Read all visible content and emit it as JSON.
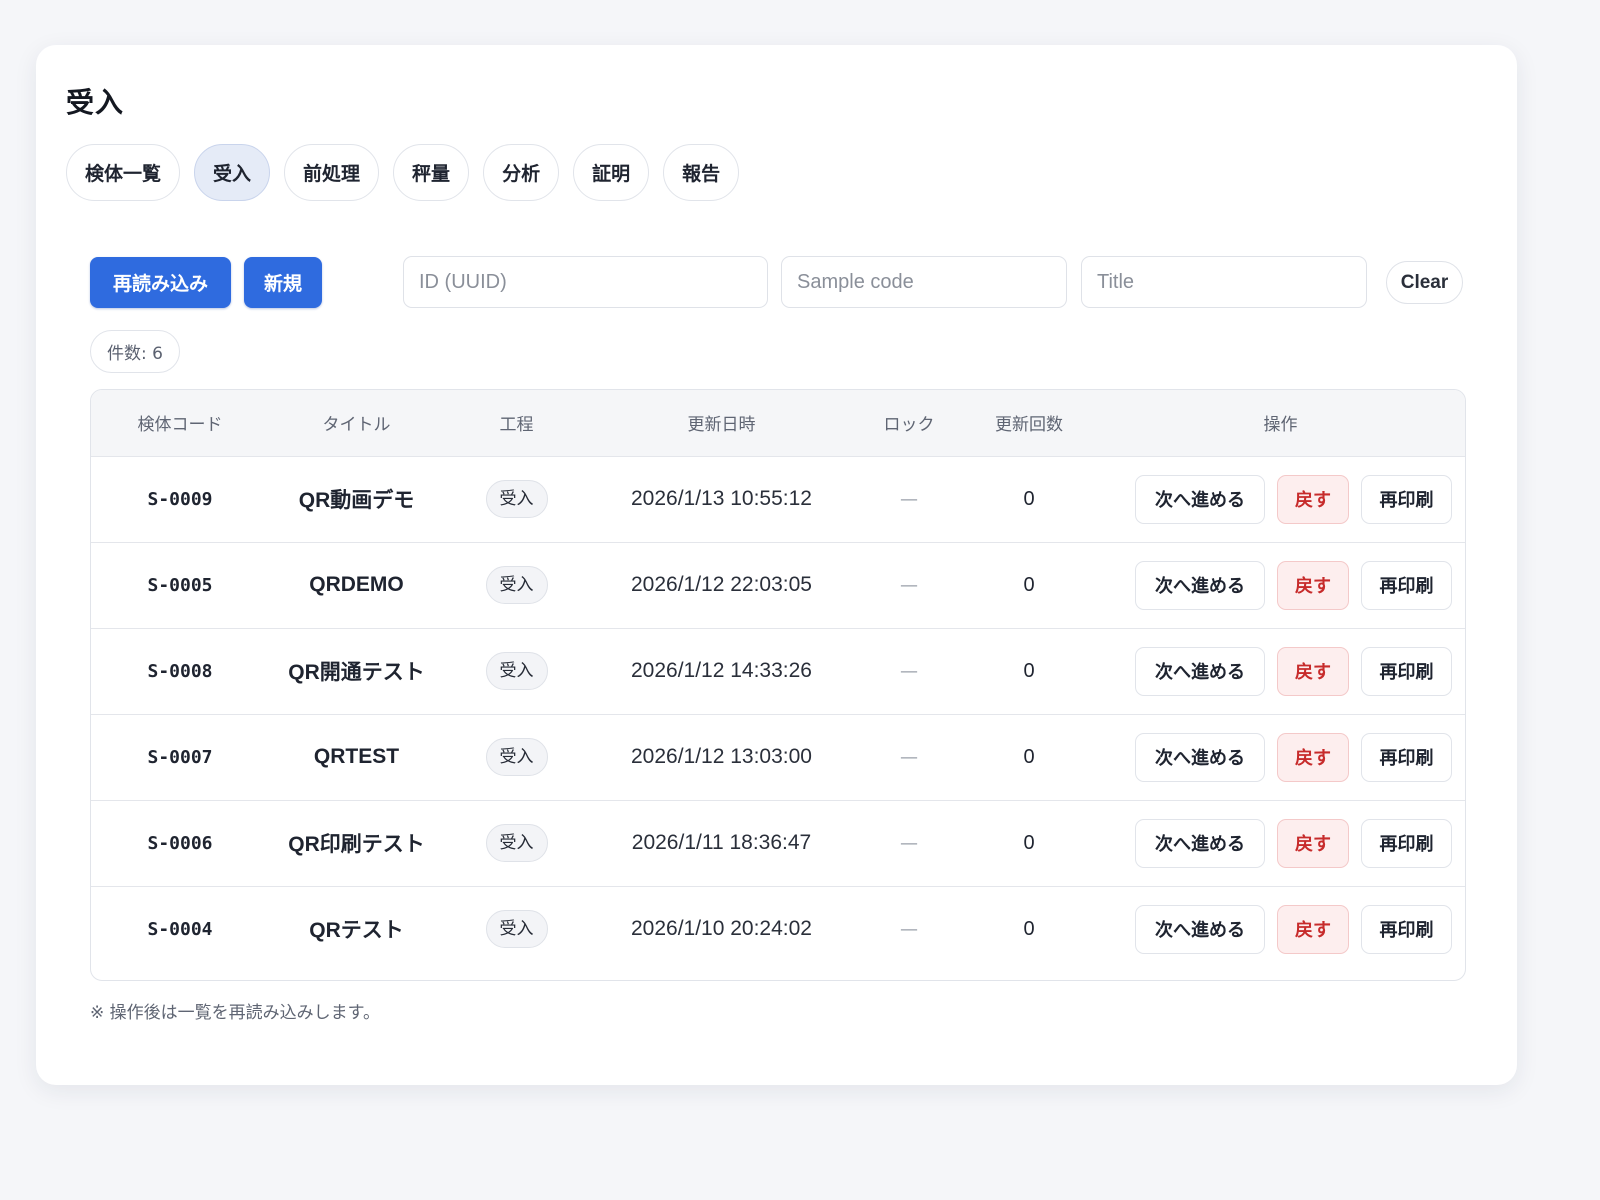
{
  "page": {
    "title": "受入"
  },
  "tabs": [
    {
      "label": "検体一覧",
      "active": false
    },
    {
      "label": "受入",
      "active": true
    },
    {
      "label": "前処理",
      "active": false
    },
    {
      "label": "秤量",
      "active": false
    },
    {
      "label": "分析",
      "active": false
    },
    {
      "label": "証明",
      "active": false
    },
    {
      "label": "報告",
      "active": false
    }
  ],
  "toolbar": {
    "reload_label": "再読み込み",
    "new_label": "新規",
    "id_placeholder": "ID (UUID)",
    "code_placeholder": "Sample code",
    "title_placeholder": "Title",
    "clear_label": "Clear"
  },
  "count": {
    "label": "件数: 6"
  },
  "table": {
    "headers": {
      "code": "検体コード",
      "title": "タイトル",
      "process": "工程",
      "updated": "更新日時",
      "lock": "ロック",
      "revisions": "更新回数",
      "ops": "操作"
    },
    "actions": {
      "next": "次へ進める",
      "back": "戻す",
      "reprint": "再印刷"
    },
    "rows": [
      {
        "code": "S-0009",
        "title": "QR動画デモ",
        "process": "受入",
        "updated": "2026/1/13 10:55:12",
        "lock": "—",
        "revisions": "0"
      },
      {
        "code": "S-0005",
        "title": "QRDEMO",
        "process": "受入",
        "updated": "2026/1/12 22:03:05",
        "lock": "—",
        "revisions": "0"
      },
      {
        "code": "S-0008",
        "title": "QR開通テスト",
        "process": "受入",
        "updated": "2026/1/12 14:33:26",
        "lock": "—",
        "revisions": "0"
      },
      {
        "code": "S-0007",
        "title": "QRTEST",
        "process": "受入",
        "updated": "2026/1/12 13:03:00",
        "lock": "—",
        "revisions": "0"
      },
      {
        "code": "S-0006",
        "title": "QR印刷テスト",
        "process": "受入",
        "updated": "2026/1/11 18:36:47",
        "lock": "—",
        "revisions": "0"
      },
      {
        "code": "S-0004",
        "title": "QRテスト",
        "process": "受入",
        "updated": "2026/1/10 20:24:02",
        "lock": "—",
        "revisions": "0"
      }
    ]
  },
  "footnote": "※ 操作後は一覧を再読み込みします。",
  "colors": {
    "primary": "#2f6bdf",
    "danger_text": "#c72b2b",
    "danger_bg": "#fdeeee",
    "active_tab_bg": "#e5ebf7"
  }
}
